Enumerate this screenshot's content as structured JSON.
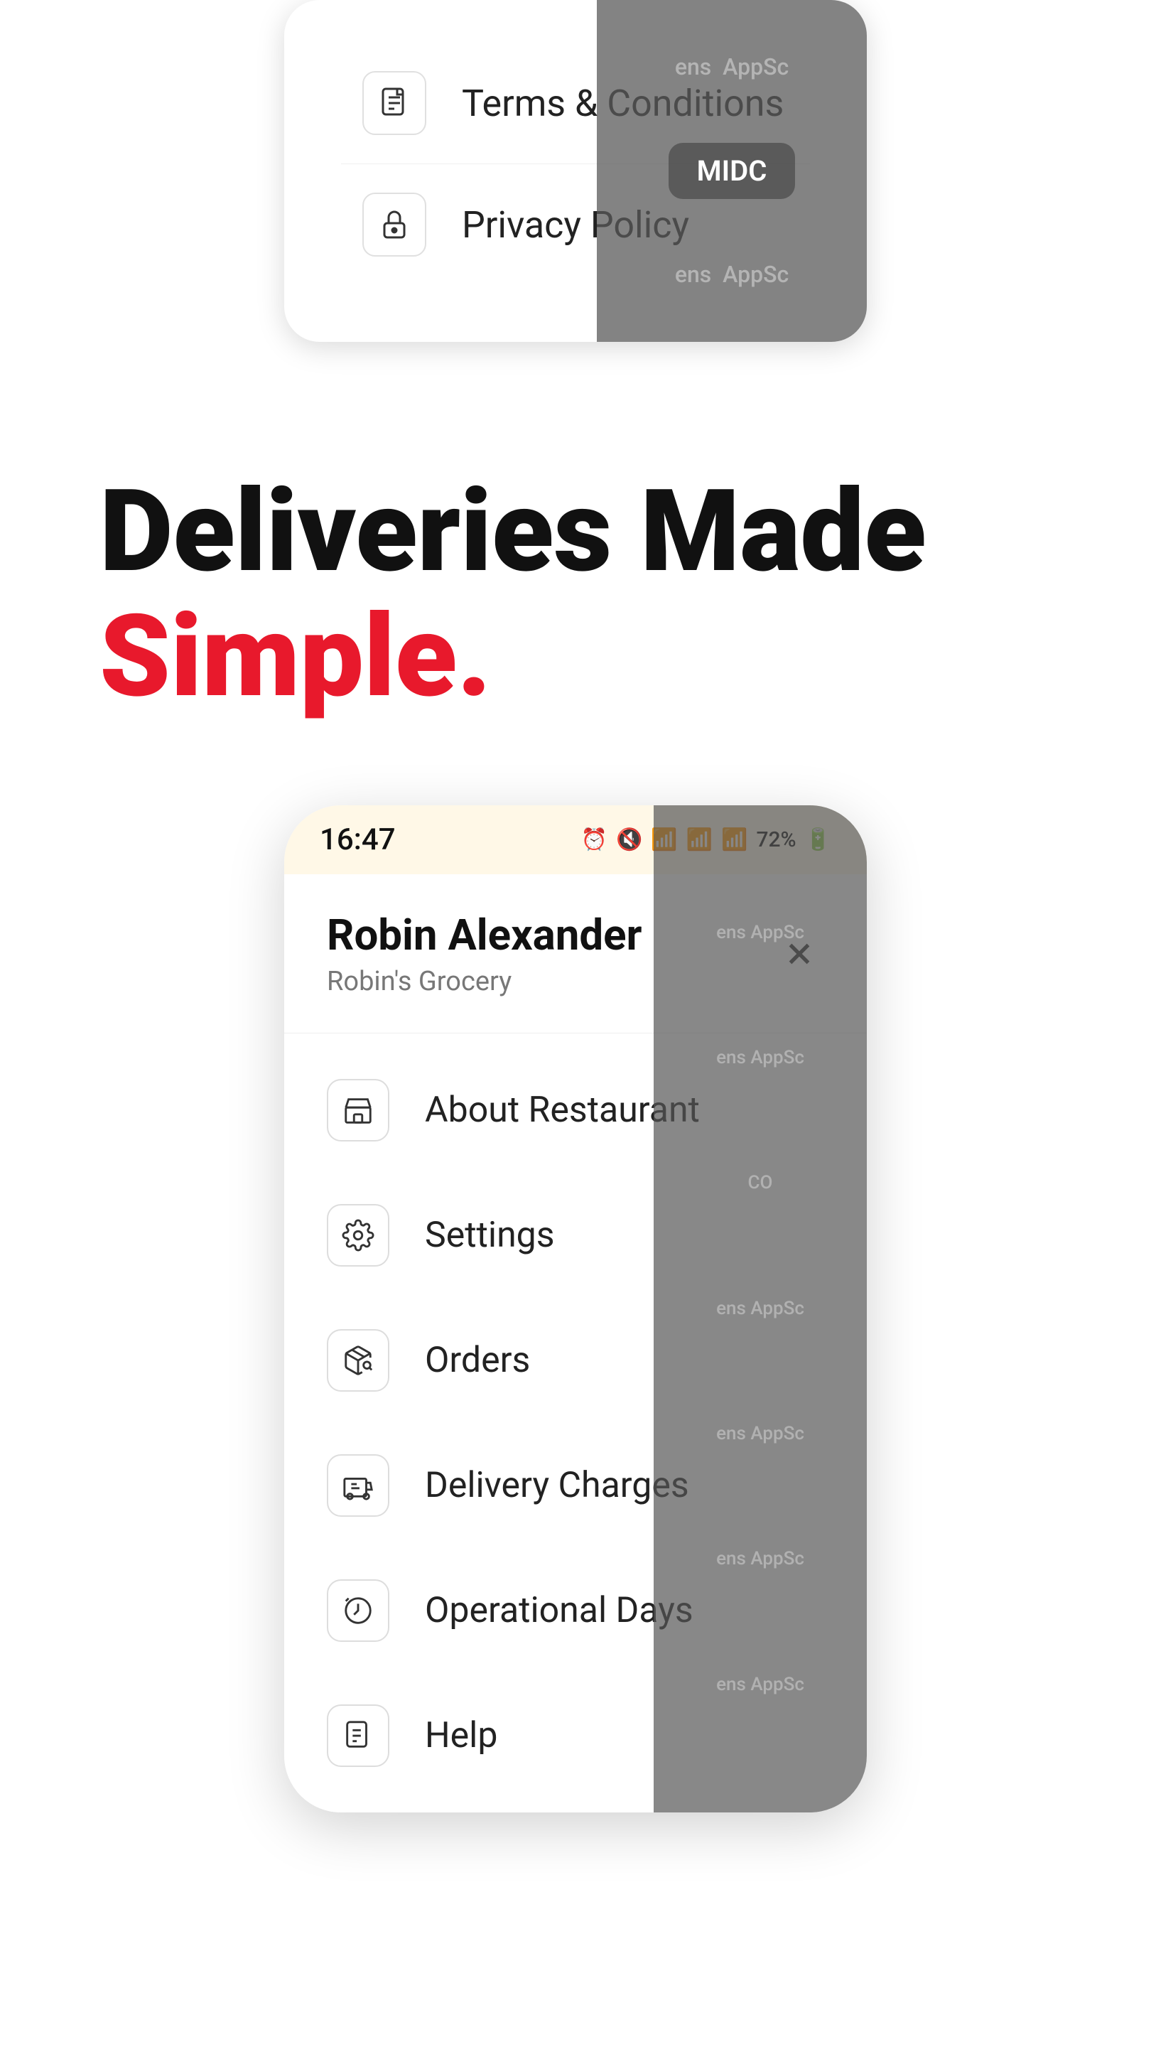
{
  "top_menu": {
    "items": [
      {
        "id": "terms",
        "label": "Terms & Conditions",
        "icon": "document-icon"
      },
      {
        "id": "privacy",
        "label": "Privacy Policy",
        "icon": "lock-icon"
      }
    ]
  },
  "hero": {
    "line1": "Deliveries Made",
    "line2": "Simple."
  },
  "phone": {
    "status_bar": {
      "time": "16:47",
      "battery": "72%"
    },
    "user": {
      "name": "Robin Alexander",
      "store": "Robin's Grocery"
    },
    "close_button_label": "×",
    "menu_items": [
      {
        "id": "about-restaurant",
        "label": "About Restaurant",
        "icon": "store-icon"
      },
      {
        "id": "settings",
        "label": "Settings",
        "icon": "settings-icon"
      },
      {
        "id": "orders",
        "label": "Orders",
        "icon": "orders-icon"
      },
      {
        "id": "delivery-charges",
        "label": "Delivery Charges",
        "icon": "delivery-icon"
      },
      {
        "id": "operational-days",
        "label": "Operational Days",
        "icon": "clock-icon"
      },
      {
        "id": "help",
        "label": "Help",
        "icon": "help-icon"
      }
    ]
  },
  "watermarks": {
    "top_right": [
      "ens",
      "AppSc",
      "MIDC"
    ],
    "phone_right": [
      "ens",
      "AppSc",
      "CO",
      "ens",
      "AppSc",
      "ens",
      "AppSc",
      "ens",
      "AppSc"
    ]
  },
  "colors": {
    "accent_red": "#e8192c",
    "text_dark": "#111111",
    "text_gray": "#777777",
    "border_light": "#eeeeee",
    "status_bar_bg": "#fff8e7",
    "watermark_bg": "rgba(85,85,85,0.7)"
  }
}
